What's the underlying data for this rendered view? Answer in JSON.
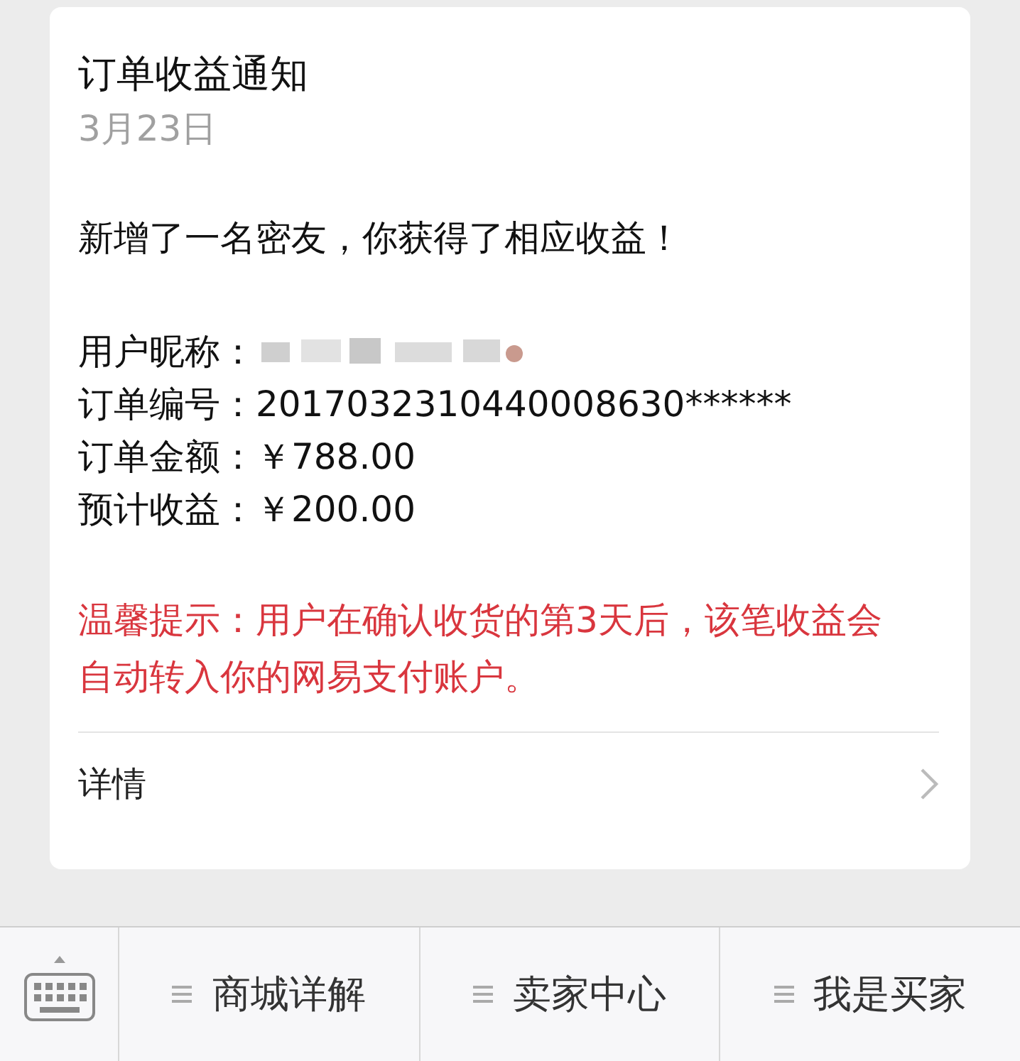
{
  "card": {
    "title": "订单收益通知",
    "date": "3月23日",
    "headline": "新增了一名密友，你获得了相应收益！",
    "fields": [
      {
        "label": "用户昵称：",
        "kind": "redacted"
      },
      {
        "label": "订单编号：",
        "kind": "text",
        "value": "2017032310440008630******"
      },
      {
        "label": "订单金额：",
        "kind": "text",
        "value": "￥788.00"
      },
      {
        "label": "预计收益：",
        "kind": "text",
        "value": "￥200.00"
      }
    ],
    "notice": "温馨提示：用户在确认收货的第3天后，该笔收益会自动转入你的网易支付账户。",
    "details_link": "详情"
  },
  "menu_bar": {
    "items": [
      {
        "label": "商城详解"
      },
      {
        "label": "卖家中心"
      },
      {
        "label": "我是买家"
      }
    ]
  }
}
